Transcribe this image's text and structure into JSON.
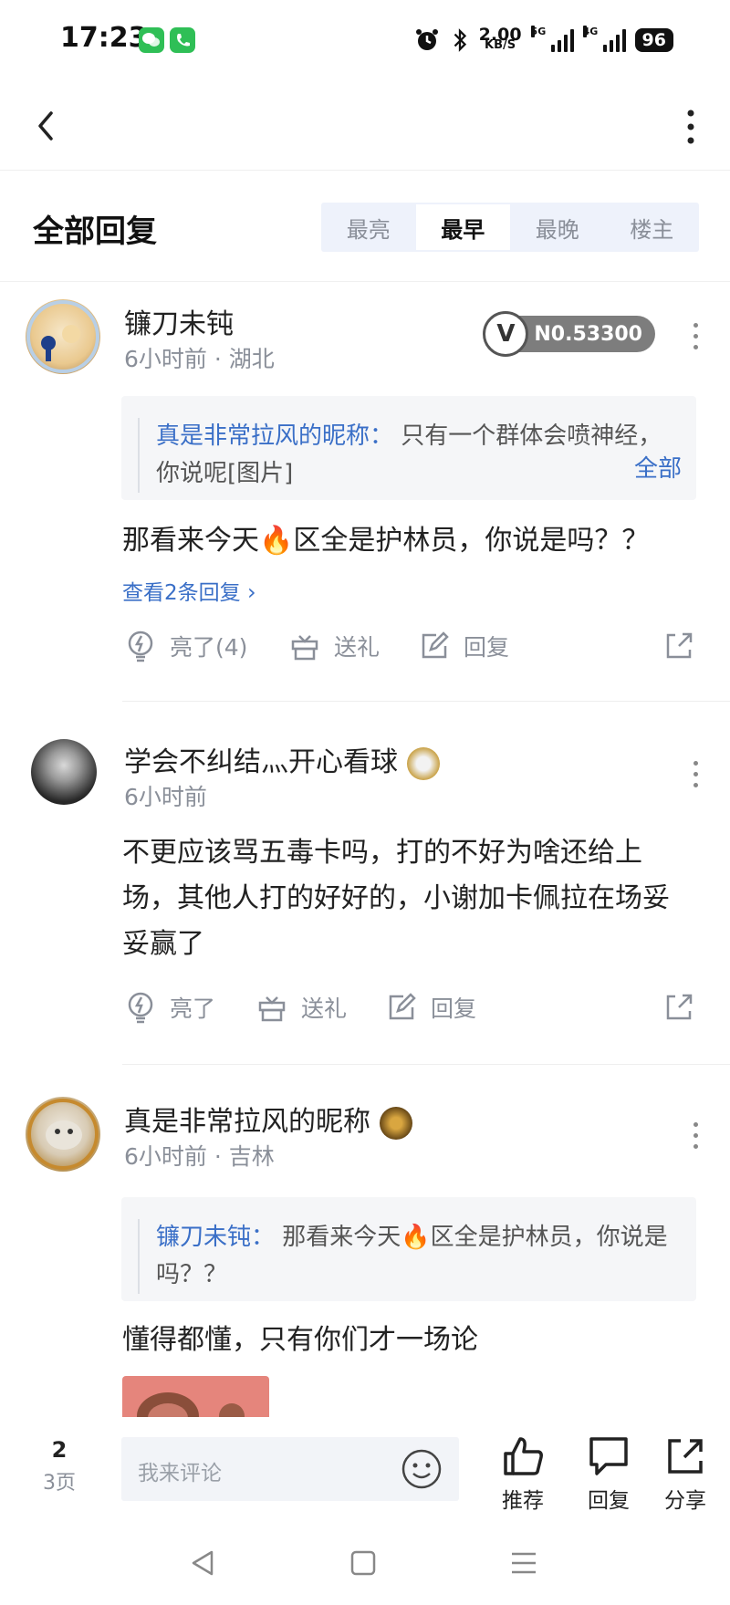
{
  "status_bar": {
    "time": "17:23",
    "net_speed_value": "2.00",
    "net_speed_unit": "KB/S",
    "network_tag_1": "5G",
    "network_tag_2": "4G",
    "battery": "96"
  },
  "header": {
    "section_title": "全部回复",
    "sort_tabs": [
      {
        "label": "最亮",
        "active": false
      },
      {
        "label": "最早",
        "active": true
      },
      {
        "label": "最晚",
        "active": false
      },
      {
        "label": "楼主",
        "active": false
      }
    ]
  },
  "comments": [
    {
      "username": "镰刀未钝",
      "meta": "6小时前 · 湖北",
      "level_badge_letter": "V",
      "level_number": "N0.53300",
      "quote": {
        "name": "真是非常拉风的昵称：",
        "text": "只有一个群体会喷神经，你说呢[图片]",
        "expand_label": "全部"
      },
      "body_text": "那看来今天🔥区全是护林员，你说是吗？？",
      "view_replies": "查看2条回复",
      "actions": {
        "like": "亮了(4)",
        "gift": "送礼",
        "reply": "回复"
      }
    },
    {
      "username": "学会不纠结灬开心看球",
      "meta": "6小时前",
      "body_text": "不更应该骂五毒卡吗，打的不好为啥还给上场，其他人打的好好的，小谢加卡佩拉在场妥妥赢了",
      "actions": {
        "like": "亮了",
        "gift": "送礼",
        "reply": "回复"
      }
    },
    {
      "username": "真是非常拉风的昵称",
      "meta": "6小时前 · 吉林",
      "quote": {
        "name": "镰刀未钝：",
        "text": "那看来今天🔥区全是护林员，你说是吗？？"
      },
      "body_text": "懂得都懂，只有你们才一场论"
    }
  ],
  "bottom_bar": {
    "page_current": "2",
    "page_total": "3页",
    "input_placeholder": "我来评论",
    "recommend_label": "推荐",
    "reply_label": "回复",
    "share_label": "分享"
  },
  "colors": {
    "link_blue": "#3a6fc7",
    "muted_gray": "#8a8f99",
    "tab_bg": "#eef2fb",
    "quote_bg": "#f5f6f8"
  }
}
